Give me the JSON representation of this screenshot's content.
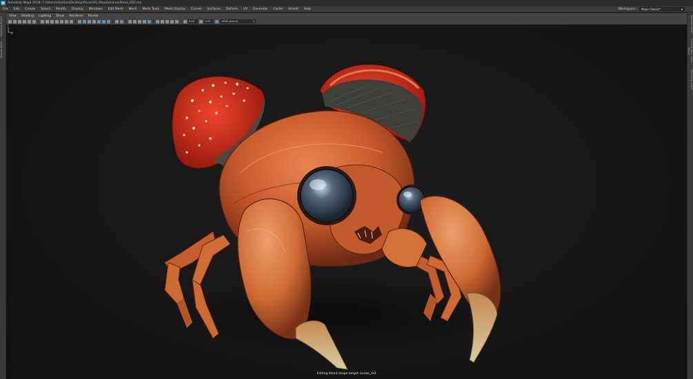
{
  "window": {
    "title": "Autodesk Maya 2018: C:\\Users\\Vladilan\\Desktop\\Paras\\01_Maya\\scenes\\Paras_002.ma",
    "logo_text": "M"
  },
  "menubar": {
    "items": [
      "File",
      "Edit",
      "Create",
      "Select",
      "Modify",
      "Display",
      "Windows",
      "Edit Mesh",
      "Mesh",
      "Mesh Tools",
      "Mesh Display",
      "Curves",
      "Surfaces",
      "Deform",
      "UV",
      "Generate",
      "Cache",
      "Arnold",
      "Help"
    ],
    "workspace_label": "Workspace :",
    "workspace_value": "Maya Classic*"
  },
  "left_tabs": [
    "Modelling Toolkit",
    "Shapes Editor"
  ],
  "right_tabs": [
    "Attribute Editor",
    "Channel Box / Layer Editor",
    "Modelling Toolkit"
  ],
  "panel_menu": {
    "items": [
      "View",
      "Shading",
      "Lighting",
      "Show",
      "Renderer",
      "Panels"
    ]
  },
  "panel_toolbar": {
    "exposure_value": "0.00",
    "gamma_value": "1.00",
    "colorspace_label": "sRGB gamma"
  },
  "viewport": {
    "status_message": "Editing blend shape target: kunas_re3",
    "axis_label_y": "Y",
    "axis_label_x": "X",
    "colors": {
      "shell": "#d9693a",
      "shell_dark": "#8f3a1d",
      "mushroom_red": "#d8301d",
      "eye": "#4a5a6a",
      "claw_tip": "#c9b98a"
    }
  }
}
